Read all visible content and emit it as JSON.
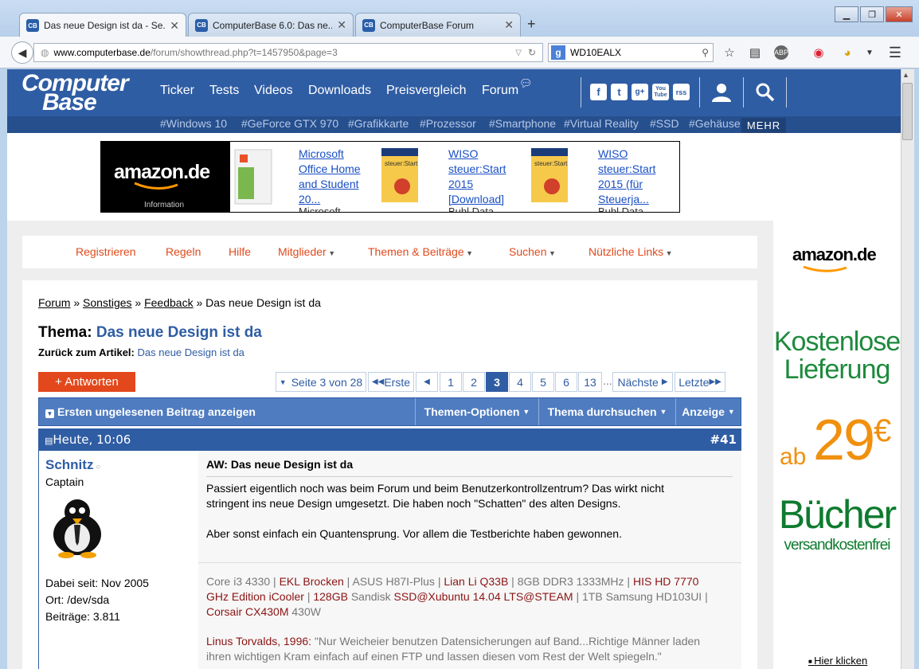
{
  "browser": {
    "tabs": [
      {
        "label": "Das neue Design ist da - Se...",
        "favicon": "CB"
      },
      {
        "label": "ComputerBase 6.0: Das ne...",
        "favicon": "CB"
      },
      {
        "label": "ComputerBase Forum",
        "favicon": "CB"
      }
    ],
    "new_tab": "+",
    "url_host": "www.computerbase.de",
    "url_rest": "/forum/showthread.php?t=1457950&page=3",
    "search_engine": "g",
    "search_value": "WD10EALX"
  },
  "site": {
    "logo_line1": "Computer",
    "logo_line2": "Base",
    "nav": [
      "Ticker",
      "Tests",
      "Videos",
      "Downloads",
      "Preisvergleich",
      "Forum"
    ],
    "social": [
      "f",
      "t",
      "g+",
      "You Tube",
      "rss"
    ],
    "hashtags": [
      "#Windows 10",
      "#GeForce GTX 970",
      "#Grafikkarte",
      "#Prozessor",
      "#Smartphone",
      "#Virtual Reality",
      "#SSD",
      "#Gehäuse"
    ],
    "mehr": "MEHR"
  },
  "banner": {
    "brand": "amazon.de",
    "info": "Information",
    "products": [
      {
        "title_lines": [
          "Microsoft",
          "Office Home",
          "and Student",
          "20..."
        ],
        "sub": "Microsoft"
      },
      {
        "title_lines": [
          "WISO",
          "steuer:Start",
          "2015",
          "[Download]"
        ],
        "sub": "Buhl Data"
      },
      {
        "title_lines": [
          "WISO",
          "steuer:Start",
          "2015 (für",
          "Steuerja..."
        ],
        "sub": "Buhl Data"
      }
    ]
  },
  "forum_nav": [
    "Registrieren",
    "Regeln",
    "Hilfe",
    "Mitglieder",
    "Themen & Beiträge",
    "Suchen",
    "Nützliche Links"
  ],
  "breadcrumb": {
    "items": [
      "Forum",
      "Sonstiges",
      "Feedback"
    ],
    "current": "Das neue Design ist da",
    "sep": "»"
  },
  "thread": {
    "thema_label": "Thema:",
    "title": "Das neue Design ist da",
    "back_label": "Zurück zum Artikel:",
    "back_link": "Das neue Design ist da",
    "reply_label": "+ Antworten"
  },
  "pagination": {
    "page_info": "Seite 3 von 28",
    "first": "Erste",
    "prev": "◀",
    "pages": [
      "1",
      "2",
      "3",
      "4",
      "5",
      "6",
      "13"
    ],
    "current": "3",
    "ellipsis": "...",
    "next": "Nächste",
    "last": "Letzte"
  },
  "threadbar": {
    "first_unread": "Ersten ungelesenen Beitrag anzeigen",
    "options": "Themen-Optionen",
    "search": "Thema durchsuchen",
    "display": "Anzeige"
  },
  "post": {
    "date": "Heute, 10:06",
    "number": "#41",
    "user": {
      "name": "Schnitz",
      "rank": "Captain",
      "joined": "Dabei seit: Nov 2005",
      "location": "Ort: /dev/sda",
      "posts": "Beiträge: 3.811"
    },
    "title": "AW: Das neue Design ist da",
    "text_p1_l1": "Passiert eigentlich noch was beim Forum und beim Benutzerkontrollzentrum? Das wirkt nicht",
    "text_p1_l2": "stringent ins neue Design umgesetzt. Die haben noch \"Schatten\" des alten Designs.",
    "text_p2": "Aber sonst einfach ein Quantensprung. Vor allem die Testberichte haben gewonnen.",
    "signature": {
      "parts_l1": [
        "Core i3 4330 | ",
        "EKL Brocken",
        " | ASUS H87I-Plus | ",
        "Lian Li Q33B",
        " | 8GB DDR3 1333MHz | ",
        "HIS HD 7770"
      ],
      "parts_l2": [
        "GHz Edition iCooler",
        " | ",
        "128GB",
        " Sandisk ",
        "SSD@Xubuntu 14.04 LTS@STEAM",
        " | 1TB Samsung HD103UI |"
      ],
      "parts_l3": [
        "Corsair CX430M",
        " 430W"
      ],
      "quote_author": "Linus Torvalds, 1996:",
      "quote_l1": " \"Nur Weicheier benutzen Datensicherungen auf Band...Richtige Männer laden",
      "quote_l2": "ihren wichtigen Kram einfach auf einen FTP und lassen diesen vom Rest der Welt spiegeln.\""
    }
  },
  "side_ad": {
    "brand": "amazon.de",
    "line1": "Kostenlose",
    "line2": "Lieferung",
    "ab": "ab",
    "price": "29",
    "currency": "€",
    "books": "Bücher",
    "free": "versandkostenfrei",
    "click": "Hier klicken"
  },
  "colors": {
    "brand_blue": "#2f5da4",
    "accent_orange": "#e2481b",
    "ad_green": "#1d8a3c",
    "ad_orange": "#f0900e"
  }
}
